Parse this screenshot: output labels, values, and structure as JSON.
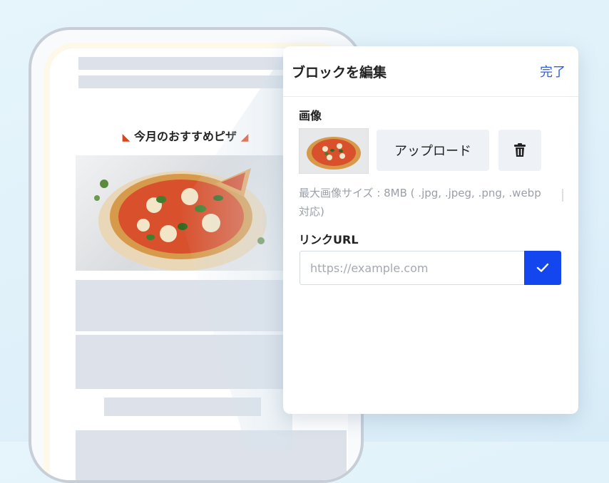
{
  "preview": {
    "promo_title": "今月のおすすめピザ",
    "promo_icon": "pizza-slice-icon",
    "promo_image": "pizza-photo"
  },
  "panel": {
    "title": "ブロックを編集",
    "done_label": "完了",
    "image_section": {
      "label": "画像",
      "thumbnail": "pizza-photo",
      "upload_label": "アップロード",
      "delete_icon": "trash-icon",
      "hint": "最大画像サイズ : 8MB ( .jpg, .jpeg, .png, .webp 対応)"
    },
    "link_section": {
      "label": "リンクURL",
      "value": "",
      "placeholder": "https://example.com",
      "confirm_icon": "check-icon"
    }
  },
  "colors": {
    "accent": "#1446f0",
    "link_text": "#2f5fe8",
    "placeholder_block": "#dde2ea",
    "background": "#e2f2fa"
  }
}
